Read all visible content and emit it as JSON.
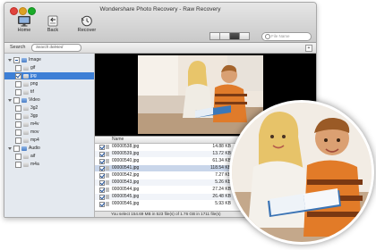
{
  "window": {
    "title": "Wondershare Photo Recovery - Raw Recovery"
  },
  "toolbar": {
    "home_label": "Home",
    "back_label": "Back",
    "recover_label": "Recover"
  },
  "top_search": {
    "placeholder": "File Name"
  },
  "search_bar": {
    "label": "Search",
    "placeholder": "Search deleted"
  },
  "sidebar": {
    "items": [
      {
        "label": "Image",
        "level": 0,
        "checkbox": "partial",
        "expanded": true,
        "selected": false
      },
      {
        "label": "gif",
        "level": 1,
        "checkbox": "unchecked",
        "selected": false
      },
      {
        "label": "jpg",
        "level": 1,
        "checkbox": "checked",
        "selected": true
      },
      {
        "label": "png",
        "level": 1,
        "checkbox": "unchecked",
        "selected": false
      },
      {
        "label": "tif",
        "level": 1,
        "checkbox": "unchecked",
        "selected": false
      },
      {
        "label": "Video",
        "level": 0,
        "checkbox": "unchecked",
        "expanded": true,
        "selected": false
      },
      {
        "label": "3g2",
        "level": 1,
        "checkbox": "unchecked",
        "selected": false
      },
      {
        "label": "3gp",
        "level": 1,
        "checkbox": "unchecked",
        "selected": false
      },
      {
        "label": "m4v",
        "level": 1,
        "checkbox": "unchecked",
        "selected": false
      },
      {
        "label": "mov",
        "level": 1,
        "checkbox": "unchecked",
        "selected": false
      },
      {
        "label": "mp4",
        "level": 1,
        "checkbox": "unchecked",
        "selected": false
      },
      {
        "label": "Audio",
        "level": 0,
        "checkbox": "unchecked",
        "expanded": true,
        "selected": false
      },
      {
        "label": "aif",
        "level": 1,
        "checkbox": "unchecked",
        "selected": false
      },
      {
        "label": "m4a",
        "level": 1,
        "checkbox": "unchecked",
        "selected": false
      }
    ]
  },
  "file_list": {
    "column_name": "Name",
    "rows": [
      {
        "name": "00000538.jpg",
        "size": "14.88 KB",
        "checked": true,
        "selected": false
      },
      {
        "name": "00000539.jpg",
        "size": "13.72 KB",
        "checked": true,
        "selected": false
      },
      {
        "name": "00000540.jpg",
        "size": "61.34 KB",
        "checked": true,
        "selected": false
      },
      {
        "name": "00000541.jpg",
        "size": "118.54 KB",
        "checked": true,
        "selected": true
      },
      {
        "name": "00000542.jpg",
        "size": "7.27 KB",
        "checked": true,
        "selected": false
      },
      {
        "name": "00000543.jpg",
        "size": "5.26 KB",
        "checked": true,
        "selected": false
      },
      {
        "name": "00000544.jpg",
        "size": "27.24 KB",
        "checked": true,
        "selected": false
      },
      {
        "name": "00000545.jpg",
        "size": "26.48 KB",
        "checked": true,
        "selected": false
      },
      {
        "name": "00000546.jpg",
        "size": "5.93 KB",
        "checked": true,
        "selected": false
      }
    ]
  },
  "status": {
    "text": "You select 154.69 MB in 523 file(s) of 1.76 GB in 1711 file(s)"
  },
  "colors": {
    "selection_blue": "#3d7fd6",
    "window_gray": "#ececec",
    "sidebar_bg": "#e4e9ef"
  },
  "icons": {
    "home": "monitor-icon",
    "back": "back-arrow-icon",
    "recover": "recover-clock-icon"
  }
}
